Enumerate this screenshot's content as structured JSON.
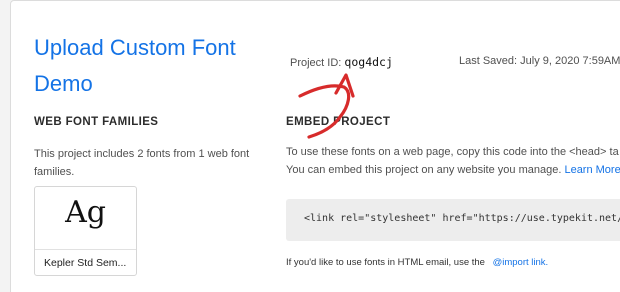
{
  "project": {
    "title": "Upload Custom Font Demo",
    "id_label": "Project ID:",
    "id_value": "qog4dcj",
    "last_saved": "Last Saved: July 9, 2020 7:59AM"
  },
  "web_fonts": {
    "heading": "WEB FONT FAMILIES",
    "description": "This project includes 2 fonts from 1 web font families.",
    "font_card": {
      "sample": "Ag",
      "name": "Kepler Std Sem..."
    }
  },
  "embed": {
    "heading": "EMBED PROJECT",
    "line1": "To use these fonts on a web page, copy this code into the <head> ta",
    "line2": "You can embed this project on any website you manage.",
    "learn_more": "Learn More",
    "code": "<link rel=\"stylesheet\" href=\"https://use.typekit.net/qog",
    "html_email_text": "If you'd like to use fonts in HTML email, use the",
    "import_link": "@import link."
  },
  "annotation": {
    "arrow_color": "#d72b2b"
  }
}
